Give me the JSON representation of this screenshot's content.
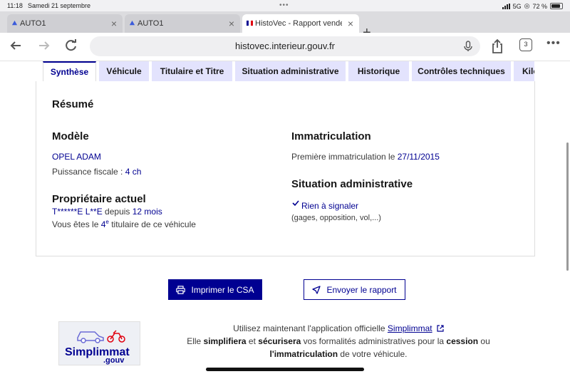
{
  "status_bar": {
    "time": "11:18",
    "date": "Samedi 21 septembre",
    "network": "5G",
    "battery": "72 %"
  },
  "browser": {
    "tabs": [
      {
        "title": "AUTO1"
      },
      {
        "title": "AUTO1"
      },
      {
        "title": "HistoVec - Rapport vendeur"
      }
    ],
    "url": "histovec.interieur.gouv.fr",
    "tab_count": "3"
  },
  "page": {
    "nav_tabs": [
      {
        "label": "Synthèse"
      },
      {
        "label": "Véhicule"
      },
      {
        "label": "Titulaire et Titre"
      },
      {
        "label": "Situation administrative"
      },
      {
        "label": "Historique"
      },
      {
        "label": "Contrôles techniques"
      },
      {
        "label": "Kilométrage"
      }
    ],
    "summary": {
      "heading": "Résumé",
      "model_heading": "Modèle",
      "model_value": "OPEL ADAM",
      "fiscal_label": "Puissance fiscale : ",
      "fiscal_value": "4 ch",
      "owner_heading": "Propriétaire actuel",
      "owner_name": "T******E L**E",
      "owner_since_label": " depuis ",
      "owner_since_value": "12 mois",
      "owner_rank_prefix": "Vous êtes le ",
      "owner_rank_number": "4",
      "owner_rank_sup": "e",
      "owner_rank_suffix": " titulaire de ce véhicule",
      "registration_heading": "Immatriculation",
      "first_registration_label": "Première immatriculation le ",
      "first_registration_date": "27/11/2015",
      "admin_heading": "Situation administrative",
      "admin_status": "Rien à signaler",
      "admin_detail": "(gages, opposition, vol,...)"
    },
    "actions": {
      "print_label": "Imprimer le CSA",
      "send_label": "Envoyer le rapport"
    },
    "promo": {
      "logo_text_1": "Simplimmat",
      "logo_text_2": ".gouv",
      "line1_prefix": "Utilisez maintenant l'application officielle ",
      "link": "Simplimmat",
      "line2_a": "Elle ",
      "line2_b": "simplifiera",
      "line2_c": " et ",
      "line2_d": "sécurisera",
      "line2_e": " vos formalités administratives pour la ",
      "line2_f": "cession",
      "line2_g": " ou",
      "line3_a": "l'immatriculation",
      "line3_b": " de votre véhicule."
    }
  },
  "colors": {
    "brand_blue": "#000091",
    "tab_bg": "#e3e3fd"
  }
}
